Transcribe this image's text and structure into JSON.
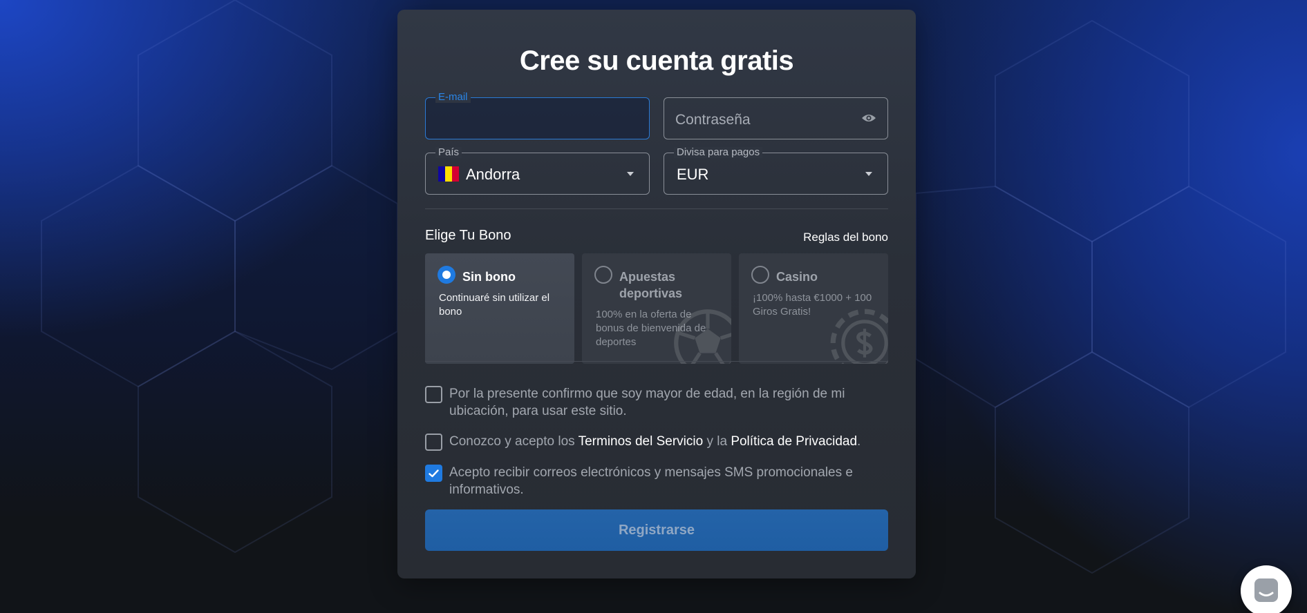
{
  "form": {
    "title": "Cree su cuenta gratis",
    "email": {
      "label": "E-mail",
      "value": ""
    },
    "password": {
      "placeholder": "Contraseña",
      "icon": "eye-icon"
    },
    "country": {
      "label": "País",
      "value": "Andorra",
      "flag_colors": [
        "#10069f",
        "#fedd00",
        "#d50032"
      ]
    },
    "currency": {
      "label": "Divisa para pagos",
      "value": "EUR"
    },
    "bonus": {
      "heading": "Elige Tu Bono",
      "rules_link": "Reglas del bono",
      "options": [
        {
          "name": "Sin bono",
          "description": "Continuaré sin utilizar el bono",
          "selected": true
        },
        {
          "name": "Apuestas deportivas",
          "description": "100% en la oferta de bonus de bienvenida de deportes",
          "selected": false,
          "icon": "soccer-ball-icon"
        },
        {
          "name": "Casino",
          "description": "¡100% hasta €1000 + 100 Giros Gratis!",
          "selected": false,
          "icon": "casino-chip-icon"
        }
      ]
    },
    "consents": {
      "age": {
        "text": "Por la presente confirmo que soy mayor de edad, en la región de mi ubicación, para usar este sitio.",
        "checked": false
      },
      "terms": {
        "prefix": "Conozco y acepto los ",
        "terms_link": "Terminos del Servicio",
        "middle": " y la ",
        "privacy_link": "Política de Privacidad",
        "suffix": ".",
        "checked": false
      },
      "marketing": {
        "text": "Acepto recibir correos electrónicos y mensajes SMS promocionales e informativos.",
        "checked": true
      }
    },
    "submit_label": "Registrarse"
  },
  "chat": {
    "icon": "chat-icon"
  },
  "colors": {
    "accent": "#1f7ae0",
    "focus": "#2a86e8",
    "button": "#2463a8"
  }
}
